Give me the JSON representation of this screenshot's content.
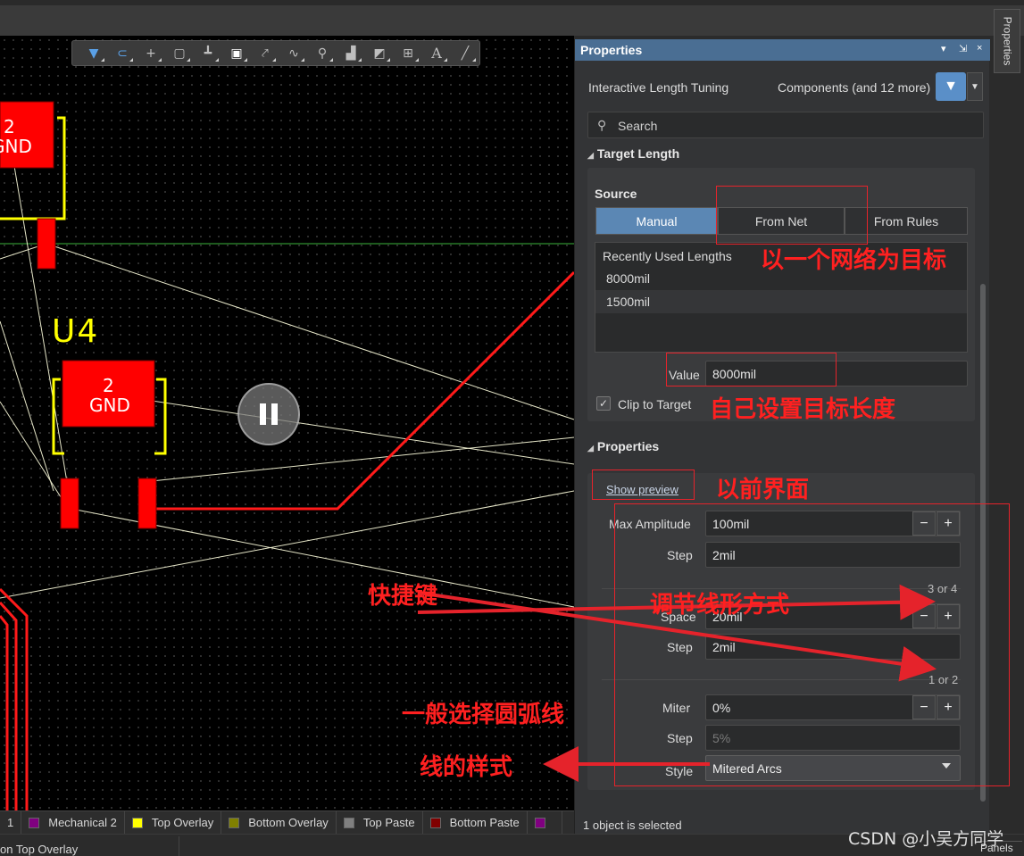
{
  "toolbar": {
    "icons": [
      "filter-icon",
      "route-icon",
      "cross-icon",
      "select-rect-icon",
      "align-icon",
      "component-icon",
      "track-icon",
      "length-tune-icon",
      "via-icon",
      "fill-icon",
      "region-icon",
      "dimension-icon",
      "text-icon",
      "line-icon"
    ]
  },
  "pcb": {
    "designator": "U4",
    "pad_number": "2",
    "net_name": "GND",
    "top_pad_number": "2",
    "top_net_name": "GND",
    "colors": {
      "copper": "#ff0000",
      "overlay": "#ffff00",
      "ratsnest": "#e8e8c8",
      "background": "#000000"
    }
  },
  "layer_tabs": [
    {
      "label": "1",
      "color": "#2b2b2b"
    },
    {
      "label": "Mechanical 2",
      "color": "#800080"
    },
    {
      "label": "Top Overlay",
      "color": "#ffff00"
    },
    {
      "label": "Bottom Overlay",
      "color": "#808000"
    },
    {
      "label": "Top Paste",
      "color": "#808080"
    },
    {
      "label": "Bottom Paste",
      "color": "#800000"
    },
    {
      "label": "",
      "color": "#800080"
    }
  ],
  "status_bar": {
    "left_text": "on Top Overlay"
  },
  "side_tab": {
    "label": "Properties"
  },
  "panels_button": "Panels",
  "panel": {
    "title": "Properties",
    "header_controls": [
      "▾",
      "⇲",
      "×"
    ],
    "mode": "Interactive Length Tuning",
    "filter_summary": "Components (and 12 more)",
    "search_placeholder": "Search",
    "target_length": {
      "title": "Target Length",
      "source_label": "Source",
      "source_options": [
        "Manual",
        "From Net",
        "From Rules"
      ],
      "active_source": "Manual",
      "recent_header": "Recently Used Lengths",
      "recent_values": [
        "8000mil",
        "1500mil"
      ],
      "value_label": "Value",
      "value": "8000mil",
      "clip_label": "Clip to Target",
      "clip_checked": true
    },
    "properties": {
      "title": "Properties",
      "show_preview": "Show preview",
      "max_amplitude_label": "Max Amplitude",
      "max_amplitude": "100mil",
      "step1_label": "Step",
      "step1": "2mil",
      "hint1": "3 or 4",
      "space_label": "Space",
      "space": "20mil",
      "step2_label": "Step",
      "step2": "2mil",
      "hint2": "1 or 2",
      "miter_label": "Miter",
      "miter": "0%",
      "step3_label": "Step",
      "step3": "5%",
      "style_label": "Style",
      "style": "Mitered Arcs"
    },
    "selection_status": "1 object is selected"
  },
  "annotations": {
    "from_net": "以一个网络为目标",
    "value": "自己设置目标长度",
    "preview": "以前界面",
    "shortcut": "快捷键",
    "adjust": "调节线形方式",
    "arc": "一般选择圆弧线",
    "style": "线的样式"
  },
  "watermark": "CSDN @小吴方同学"
}
